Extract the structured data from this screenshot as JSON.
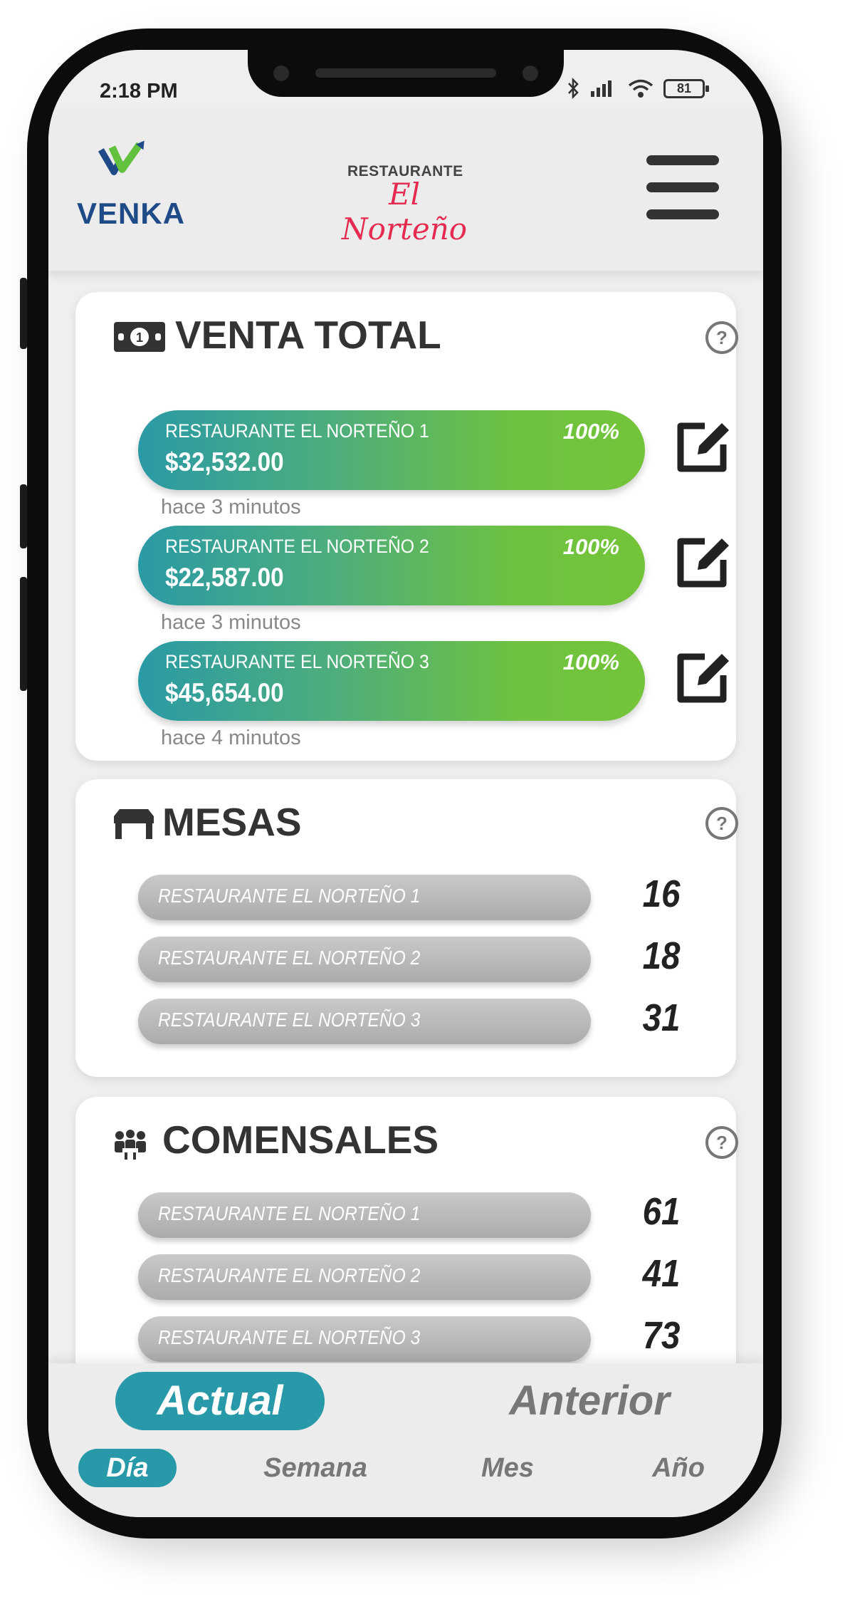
{
  "status_bar": {
    "time": "2:18 PM",
    "battery": "81"
  },
  "header": {
    "brand": "VENKA",
    "restaurant_small": "RESTAURANTE",
    "restaurant_script": "El Norteño"
  },
  "venta_total": {
    "title": "VENTA TOTAL",
    "items": [
      {
        "name": "RESTAURANTE EL NORTEÑO 1",
        "amount": "$32,532.00",
        "percent": "100%",
        "time": "hace 3 minutos"
      },
      {
        "name": "RESTAURANTE EL NORTEÑO 2",
        "amount": "$22,587.00",
        "percent": "100%",
        "time": "hace 3 minutos"
      },
      {
        "name": "RESTAURANTE EL NORTEÑO 3",
        "amount": "$45,654.00",
        "percent": "100%",
        "time": "hace 4 minutos"
      }
    ]
  },
  "mesas": {
    "title": "MESAS",
    "items": [
      {
        "name": "RESTAURANTE EL NORTEÑO 1",
        "value": "16"
      },
      {
        "name": "RESTAURANTE EL NORTEÑO 2",
        "value": "18"
      },
      {
        "name": "RESTAURANTE EL NORTEÑO 3",
        "value": "31"
      }
    ]
  },
  "comensales": {
    "title": "COMENSALES",
    "items": [
      {
        "name": "RESTAURANTE EL NORTEÑO 1",
        "value": "61"
      },
      {
        "name": "RESTAURANTE EL NORTEÑO 2",
        "value": "41"
      },
      {
        "name": "RESTAURANTE EL NORTEÑO 3",
        "value": "73"
      }
    ]
  },
  "bottom_nav": {
    "tabs": [
      "Actual",
      "Anterior"
    ],
    "periods": [
      "Día",
      "Semana",
      "Mes",
      "Año"
    ]
  },
  "colors": {
    "accent": "#2899a8",
    "green": "#74c43a",
    "brand_blue": "#1e4b87",
    "brand_red": "#e52b50"
  }
}
